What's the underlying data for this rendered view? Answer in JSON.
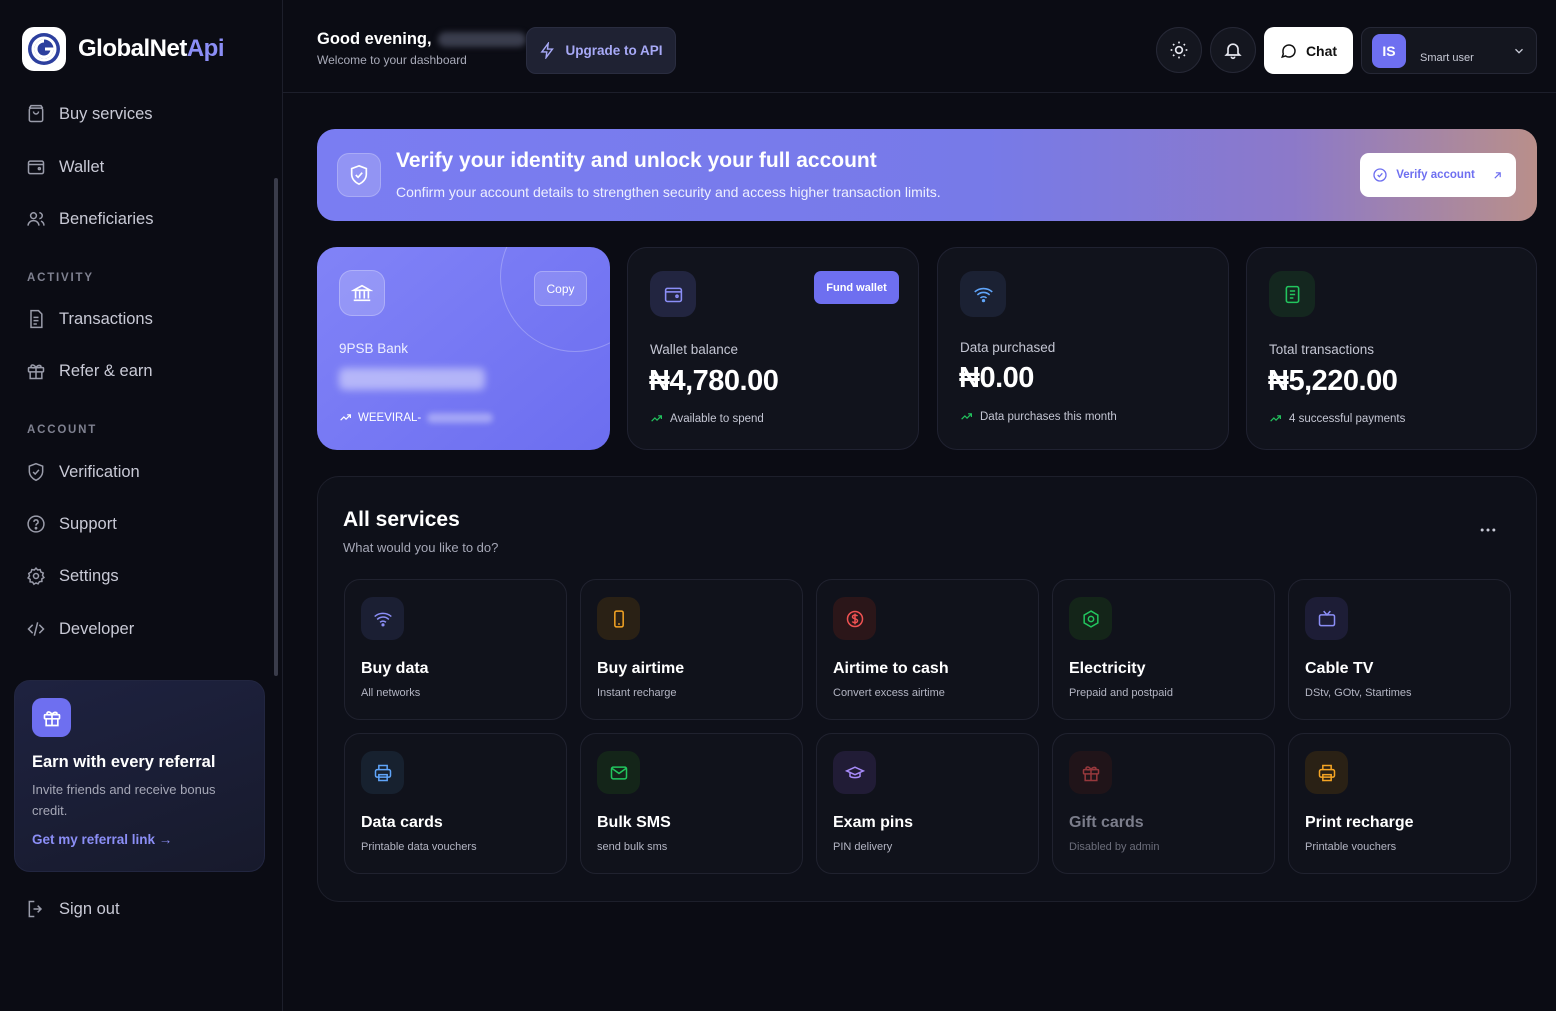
{
  "brand": {
    "name_main": "GlobalNet",
    "name_accent": "Api"
  },
  "sidebar": {
    "items_top": [
      {
        "label": "Buy services",
        "icon": "shopping-bag-icon"
      },
      {
        "label": "Wallet",
        "icon": "wallet-icon"
      },
      {
        "label": "Beneficiaries",
        "icon": "users-icon"
      }
    ],
    "activity_label": "ACTIVITY",
    "items_activity": [
      {
        "label": "Transactions",
        "icon": "receipt-icon"
      },
      {
        "label": "Refer & earn",
        "icon": "gift-icon"
      }
    ],
    "account_label": "ACCOUNT",
    "items_account": [
      {
        "label": "Verification",
        "icon": "shield-check-icon"
      },
      {
        "label": "Support",
        "icon": "help-circle-icon"
      },
      {
        "label": "Settings",
        "icon": "gear-icon"
      },
      {
        "label": "Developer",
        "icon": "code-icon"
      }
    ],
    "promo": {
      "title": "Earn with every referral",
      "text": "Invite friends and receive bonus credit.",
      "link": "Get my referral link →"
    },
    "sign_out": "Sign out"
  },
  "header": {
    "greeting": "Good evening,",
    "subtitle": "Welcome to your dashboard",
    "upgrade_label": "Upgrade to API",
    "chat_label": "Chat",
    "user_initials": "IS",
    "user_role": "Smart user"
  },
  "banner": {
    "title": "Verify your identity and unlock your full account",
    "subtitle": "Confirm your account details to strengthen security and access higher transaction limits.",
    "button": "Verify account"
  },
  "cards": {
    "bank": {
      "copy_label": "Copy",
      "bank_name": "9PSB Bank",
      "ref_prefix": "WEEVIRAL-"
    },
    "wallet": {
      "fund_label": "Fund wallet",
      "label": "Wallet balance",
      "value": "₦4,780.00",
      "note": "Available to spend"
    },
    "data": {
      "label": "Data purchased",
      "value": "₦0.00",
      "note": "Data purchases this month"
    },
    "transactions": {
      "label": "Total transactions",
      "value": "₦5,220.00",
      "note": "4 successful payments"
    }
  },
  "services": {
    "title": "All services",
    "subtitle": "What would you like to do?",
    "tiles": [
      {
        "name": "Buy data",
        "sub": "All networks",
        "icon": "wifi-icon",
        "color": "#8b8ef6"
      },
      {
        "name": "Buy airtime",
        "sub": "Instant recharge",
        "icon": "phone-icon",
        "color": "#f5a524"
      },
      {
        "name": "Airtime to cash",
        "sub": "Convert excess airtime",
        "icon": "dollar-circle-icon",
        "color": "#f05252"
      },
      {
        "name": "Electricity",
        "sub": "Prepaid and postpaid",
        "icon": "hexagon-icon",
        "color": "#22c55e"
      },
      {
        "name": "Cable TV",
        "sub": "DStv, GOtv, Startimes",
        "icon": "tv-icon",
        "color": "#8b8ef6"
      },
      {
        "name": "Data cards",
        "sub": "Printable data vouchers",
        "icon": "printer-icon",
        "color": "#60a5fa"
      },
      {
        "name": "Bulk SMS",
        "sub": "send bulk sms",
        "icon": "mail-icon",
        "color": "#22c55e"
      },
      {
        "name": "Exam pins",
        "sub": "PIN delivery",
        "icon": "graduation-cap-icon",
        "color": "#a78bfa"
      },
      {
        "name": "Gift cards",
        "sub": "Disabled by admin",
        "icon": "gift-icon",
        "color": "#f05252"
      },
      {
        "name": "Print recharge",
        "sub": "Printable vouchers",
        "icon": "printer-icon",
        "color": "#f5a524"
      }
    ]
  }
}
